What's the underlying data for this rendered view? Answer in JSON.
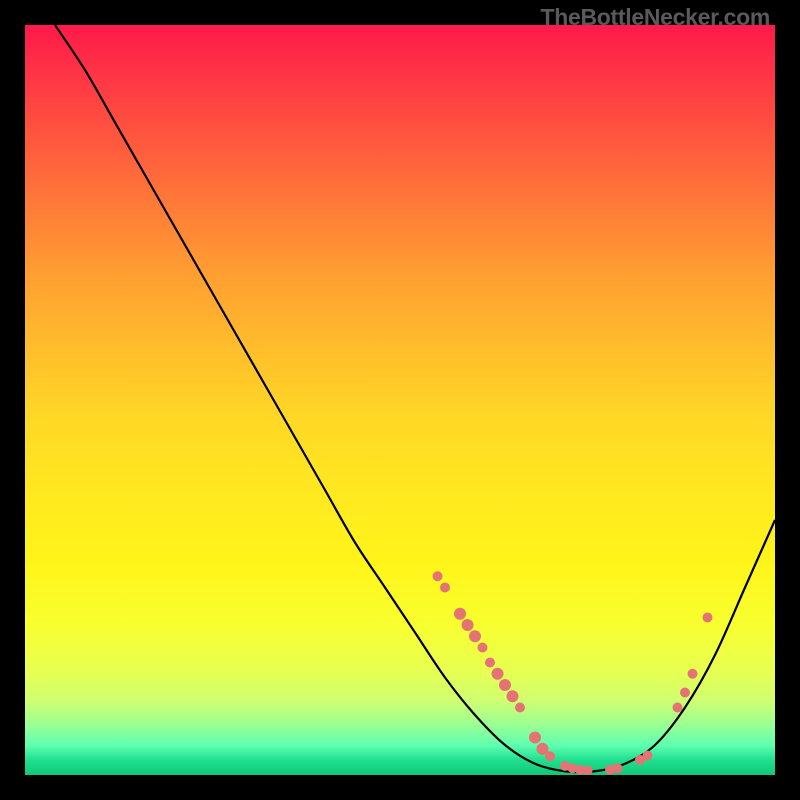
{
  "watermark": "TheBottleNecker.com",
  "chart_data": {
    "type": "line",
    "title": "",
    "xlabel": "",
    "ylabel": "",
    "xlim": [
      0,
      100
    ],
    "ylim": [
      0,
      100
    ],
    "grid": false,
    "legend": false,
    "series": [
      {
        "name": "bottleneck-curve",
        "color": "#000000",
        "points": [
          {
            "x": 4,
            "y": 100
          },
          {
            "x": 8,
            "y": 94
          },
          {
            "x": 12,
            "y": 87
          },
          {
            "x": 16,
            "y": 80
          },
          {
            "x": 20,
            "y": 73
          },
          {
            "x": 24,
            "y": 66
          },
          {
            "x": 28,
            "y": 59
          },
          {
            "x": 32,
            "y": 52
          },
          {
            "x": 36,
            "y": 45
          },
          {
            "x": 40,
            "y": 38
          },
          {
            "x": 44,
            "y": 31
          },
          {
            "x": 48,
            "y": 25
          },
          {
            "x": 52,
            "y": 19
          },
          {
            "x": 56,
            "y": 13
          },
          {
            "x": 60,
            "y": 8
          },
          {
            "x": 64,
            "y": 4
          },
          {
            "x": 68,
            "y": 1.5
          },
          {
            "x": 72,
            "y": 0.5
          },
          {
            "x": 76,
            "y": 0.5
          },
          {
            "x": 80,
            "y": 1.5
          },
          {
            "x": 84,
            "y": 4
          },
          {
            "x": 88,
            "y": 9
          },
          {
            "x": 92,
            "y": 16
          },
          {
            "x": 96,
            "y": 25
          },
          {
            "x": 100,
            "y": 34
          }
        ]
      }
    ],
    "markers": [
      {
        "x": 55,
        "y": 26.5,
        "r": 5
      },
      {
        "x": 56,
        "y": 25.0,
        "r": 5
      },
      {
        "x": 58,
        "y": 21.5,
        "r": 6
      },
      {
        "x": 59,
        "y": 20.0,
        "r": 6
      },
      {
        "x": 60,
        "y": 18.5,
        "r": 6
      },
      {
        "x": 61,
        "y": 17.0,
        "r": 5
      },
      {
        "x": 62,
        "y": 15.0,
        "r": 5
      },
      {
        "x": 63,
        "y": 13.5,
        "r": 6
      },
      {
        "x": 64,
        "y": 12.0,
        "r": 6
      },
      {
        "x": 65,
        "y": 10.5,
        "r": 6
      },
      {
        "x": 66,
        "y": 9.0,
        "r": 5
      },
      {
        "x": 68,
        "y": 5.0,
        "r": 6
      },
      {
        "x": 69,
        "y": 3.5,
        "r": 6
      },
      {
        "x": 70,
        "y": 2.5,
        "r": 5
      },
      {
        "x": 72,
        "y": 1.2,
        "r": 5
      },
      {
        "x": 73,
        "y": 0.9,
        "r": 5
      },
      {
        "x": 74,
        "y": 0.7,
        "r": 5
      },
      {
        "x": 75,
        "y": 0.6,
        "r": 5
      },
      {
        "x": 78,
        "y": 0.7,
        "r": 5
      },
      {
        "x": 79,
        "y": 0.9,
        "r": 5
      },
      {
        "x": 82,
        "y": 2.0,
        "r": 5
      },
      {
        "x": 83,
        "y": 2.6,
        "r": 5
      },
      {
        "x": 87,
        "y": 9.0,
        "r": 5
      },
      {
        "x": 88,
        "y": 11.0,
        "r": 5
      },
      {
        "x": 89,
        "y": 13.5,
        "r": 5
      },
      {
        "x": 91,
        "y": 21.0,
        "r": 5
      }
    ],
    "marker_color": "#e57373"
  }
}
